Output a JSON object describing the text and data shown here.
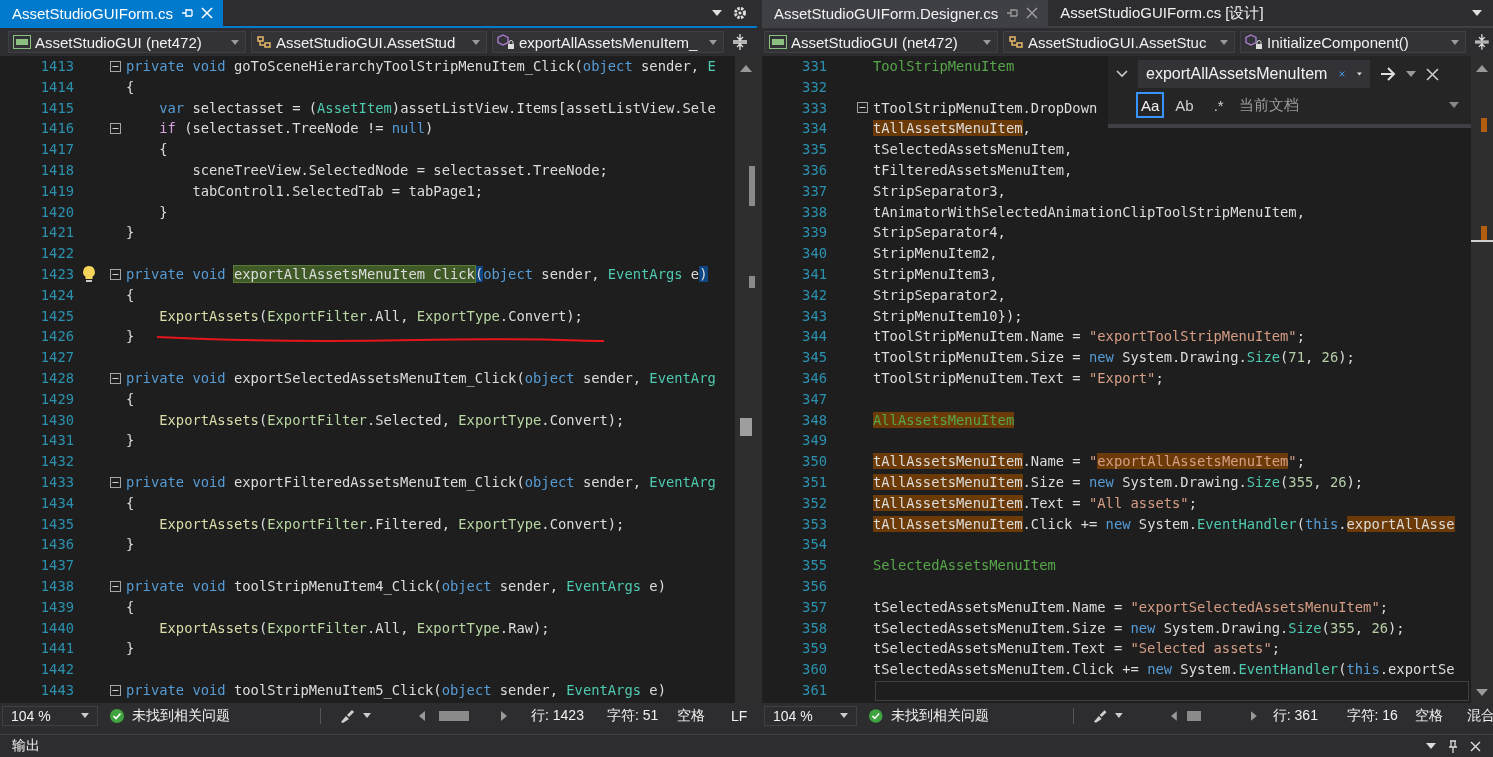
{
  "panes": [
    {
      "focused": true,
      "tabs": [
        {
          "label": "AssetStudioGUIForm.cs",
          "selected": true
        }
      ],
      "nav": {
        "project": "AssetStudioGUI (net472)",
        "class": "AssetStudioGUI.AssetStud",
        "member": "exportAllAssetsMenuItem_"
      },
      "lines": [
        {
          "n": "1413",
          "fold": true,
          "tokens": [
            {
              "text": "private void ",
              "kind": "kw"
            },
            {
              "text": "goToSceneHierarchyToolStripMenuItem_Click(",
              "kind": "plain"
            },
            {
              "text": "object ",
              "kind": "kw"
            },
            {
              "text": "sender, ",
              "kind": "plain"
            },
            {
              "text": "E",
              "kind": "type"
            }
          ]
        },
        {
          "n": "1414",
          "tokens": [
            {
              "text": "{",
              "kind": "plain"
            }
          ]
        },
        {
          "n": "1415",
          "tokens": [
            {
              "text": "    var",
              "kind": "kw"
            },
            {
              "text": " selectasset = (",
              "kind": "plain"
            },
            {
              "text": "AssetItem",
              "kind": "type"
            },
            {
              "text": ")assetListView.Items[assetListView.Sele",
              "kind": "plain"
            }
          ]
        },
        {
          "n": "1416",
          "fold": true,
          "tokens": [
            {
              "text": "    if",
              "kind": "ctrl"
            },
            {
              "text": " (selectasset.TreeNode != ",
              "kind": "plain"
            },
            {
              "text": "null",
              "kind": "kw"
            },
            {
              "text": ")",
              "kind": "plain"
            }
          ]
        },
        {
          "n": "1417",
          "tokens": [
            {
              "text": "    {",
              "kind": "plain"
            }
          ]
        },
        {
          "n": "1418",
          "tokens": [
            {
              "text": "        sceneTreeView.SelectedNode = selectasset.TreeNode;",
              "kind": "plain"
            }
          ]
        },
        {
          "n": "1419",
          "tokens": [
            {
              "text": "        tabControl1.SelectedTab = tabPage1;",
              "kind": "plain"
            }
          ]
        },
        {
          "n": "1420",
          "tokens": [
            {
              "text": "    }",
              "kind": "plain"
            }
          ]
        },
        {
          "n": "1421",
          "tokens": [
            {
              "text": "}",
              "kind": "plain"
            }
          ]
        },
        {
          "n": "1422"
        },
        {
          "n": "1423",
          "fold": true,
          "lightbulb": true,
          "tokens": [
            {
              "text": "private void ",
              "kind": "kw"
            },
            {
              "text": "exportAllAssetsMenuItem_Click",
              "kind": "plain",
              "definition_match": true
            },
            {
              "text": "(",
              "kind": "plain",
              "brace_match": true
            },
            {
              "text": "object ",
              "kind": "kw"
            },
            {
              "text": "sender, ",
              "kind": "plain"
            },
            {
              "text": "EventArgs",
              "kind": "type"
            },
            {
              "text": " e",
              "kind": "plain"
            },
            {
              "text": ")",
              "kind": "plain",
              "brace_match": true
            }
          ]
        },
        {
          "n": "1424",
          "tokens": [
            {
              "text": "{",
              "kind": "plain"
            }
          ]
        },
        {
          "n": "1425",
          "tokens": [
            {
              "text": "    ExportAssets",
              "kind": "method"
            },
            {
              "text": "(",
              "kind": "plain"
            },
            {
              "text": "ExportFilter",
              "kind": "enum"
            },
            {
              "text": ".All, ",
              "kind": "plain"
            },
            {
              "text": "ExportType",
              "kind": "enum"
            },
            {
              "text": ".Convert);",
              "kind": "plain"
            }
          ]
        },
        {
          "n": "1426",
          "tokens": [
            {
              "text": "}",
              "kind": "plain"
            }
          ]
        },
        {
          "n": "1427"
        },
        {
          "n": "1428",
          "fold": true,
          "tokens": [
            {
              "text": "private void ",
              "kind": "kw"
            },
            {
              "text": "exportSelectedAssetsMenuItem_Click(",
              "kind": "plain"
            },
            {
              "text": "object ",
              "kind": "kw"
            },
            {
              "text": "sender, ",
              "kind": "plain"
            },
            {
              "text": "EventArg",
              "kind": "type"
            }
          ]
        },
        {
          "n": "1429",
          "tokens": [
            {
              "text": "{",
              "kind": "plain"
            }
          ]
        },
        {
          "n": "1430",
          "tokens": [
            {
              "text": "    ExportAssets",
              "kind": "method"
            },
            {
              "text": "(",
              "kind": "plain"
            },
            {
              "text": "ExportFilter",
              "kind": "enum"
            },
            {
              "text": ".Selected, ",
              "kind": "plain"
            },
            {
              "text": "ExportType",
              "kind": "enum"
            },
            {
              "text": ".Convert);",
              "kind": "plain"
            }
          ]
        },
        {
          "n": "1431",
          "tokens": [
            {
              "text": "}",
              "kind": "plain"
            }
          ]
        },
        {
          "n": "1432"
        },
        {
          "n": "1433",
          "fold": true,
          "tokens": [
            {
              "text": "private void ",
              "kind": "kw"
            },
            {
              "text": "exportFilteredAssetsMenuItem_Click(",
              "kind": "plain"
            },
            {
              "text": "object ",
              "kind": "kw"
            },
            {
              "text": "sender, ",
              "kind": "plain"
            },
            {
              "text": "EventArg",
              "kind": "type"
            }
          ]
        },
        {
          "n": "1434",
          "tokens": [
            {
              "text": "{",
              "kind": "plain"
            }
          ]
        },
        {
          "n": "1435",
          "tokens": [
            {
              "text": "    ExportAssets",
              "kind": "method"
            },
            {
              "text": "(",
              "kind": "plain"
            },
            {
              "text": "ExportFilter",
              "kind": "enum"
            },
            {
              "text": ".Filtered, ",
              "kind": "plain"
            },
            {
              "text": "ExportType",
              "kind": "enum"
            },
            {
              "text": ".Convert);",
              "kind": "plain"
            }
          ]
        },
        {
          "n": "1436",
          "tokens": [
            {
              "text": "}",
              "kind": "plain"
            }
          ]
        },
        {
          "n": "1437"
        },
        {
          "n": "1438",
          "fold": true,
          "tokens": [
            {
              "text": "private void ",
              "kind": "kw"
            },
            {
              "text": "toolStripMenuItem4_Click(",
              "kind": "plain"
            },
            {
              "text": "object ",
              "kind": "kw"
            },
            {
              "text": "sender, ",
              "kind": "plain"
            },
            {
              "text": "EventArgs",
              "kind": "type"
            },
            {
              "text": " e)",
              "kind": "plain"
            }
          ]
        },
        {
          "n": "1439",
          "tokens": [
            {
              "text": "{",
              "kind": "plain"
            }
          ]
        },
        {
          "n": "1440",
          "tokens": [
            {
              "text": "    ExportAssets",
              "kind": "method"
            },
            {
              "text": "(",
              "kind": "plain"
            },
            {
              "text": "ExportFilter",
              "kind": "enum"
            },
            {
              "text": ".All, ",
              "kind": "plain"
            },
            {
              "text": "ExportType",
              "kind": "enum"
            },
            {
              "text": ".Raw);",
              "kind": "plain"
            }
          ]
        },
        {
          "n": "1441",
          "tokens": [
            {
              "text": "}",
              "kind": "plain"
            }
          ]
        },
        {
          "n": "1442"
        },
        {
          "n": "1443",
          "fold": true,
          "tokens": [
            {
              "text": "private void ",
              "kind": "kw"
            },
            {
              "text": "toolStripMenuItem5_Click(",
              "kind": "plain"
            },
            {
              "text": "object ",
              "kind": "kw"
            },
            {
              "text": "sender, ",
              "kind": "plain"
            },
            {
              "text": "EventArgs",
              "kind": "type"
            },
            {
              "text": " e)",
              "kind": "plain"
            }
          ]
        }
      ],
      "status": {
        "zoom": "104 %",
        "issues": "未找到相关问题",
        "line": "行: 1423",
        "char": "字符: 51",
        "indent": "空格",
        "eol": "LF"
      }
    },
    {
      "focused": false,
      "tabs": [
        {
          "label": "AssetStudioGUIForm.Designer.cs",
          "selected": true
        },
        {
          "label": "AssetStudioGUIForm.cs [设计]",
          "selected": false
        }
      ],
      "nav": {
        "project": "AssetStudioGUI (net472)",
        "class": "AssetStudioGUI.AssetStuc",
        "member": "InitializeComponent()"
      },
      "lines": [
        {
          "n": "331",
          "tokens": [
            {
              "text": "ToolStripMenuItem",
              "kind": "comment"
            }
          ]
        },
        {
          "n": "332"
        },
        {
          "n": "333",
          "fold": true,
          "tokens": [
            {
              "text": "tToolStripMenuItem.DropDown",
              "kind": "plain"
            }
          ]
        },
        {
          "n": "334",
          "tokens": [
            {
              "text": "tAllAssetsMenuItem",
              "kind": "plain",
              "search_match": true
            },
            {
              "text": ",",
              "kind": "plain"
            }
          ]
        },
        {
          "n": "335",
          "tokens": [
            {
              "text": "tSelectedAssetsMenuItem,",
              "kind": "plain"
            }
          ]
        },
        {
          "n": "336",
          "tokens": [
            {
              "text": "tFilteredAssetsMenuItem,",
              "kind": "plain"
            }
          ]
        },
        {
          "n": "337",
          "tokens": [
            {
              "text": "StripSeparator3,",
              "kind": "plain"
            }
          ]
        },
        {
          "n": "338",
          "tokens": [
            {
              "text": "tAnimatorWithSelectedAnimationClipToolStripMenuItem,",
              "kind": "plain"
            }
          ]
        },
        {
          "n": "339",
          "tokens": [
            {
              "text": "StripSeparator4,",
              "kind": "plain"
            }
          ]
        },
        {
          "n": "340",
          "tokens": [
            {
              "text": "StripMenuItem2,",
              "kind": "plain"
            }
          ]
        },
        {
          "n": "341",
          "tokens": [
            {
              "text": "StripMenuItem3,",
              "kind": "plain"
            }
          ]
        },
        {
          "n": "342",
          "tokens": [
            {
              "text": "StripSeparator2,",
              "kind": "plain"
            }
          ]
        },
        {
          "n": "343",
          "tokens": [
            {
              "text": "StripMenuItem10});",
              "kind": "plain"
            }
          ]
        },
        {
          "n": "344",
          "tokens": [
            {
              "text": "tToolStripMenuItem.Name = ",
              "kind": "plain"
            },
            {
              "text": "\"exportToolStripMenuItem\"",
              "kind": "str"
            },
            {
              "text": ";",
              "kind": "plain"
            }
          ]
        },
        {
          "n": "345",
          "tokens": [
            {
              "text": "tToolStripMenuItem.Size = ",
              "kind": "plain"
            },
            {
              "text": "new",
              "kind": "kw"
            },
            {
              "text": " System.Drawing.",
              "kind": "plain"
            },
            {
              "text": "Size",
              "kind": "type"
            },
            {
              "text": "(",
              "kind": "plain"
            },
            {
              "text": "71",
              "kind": "num"
            },
            {
              "text": ", ",
              "kind": "plain"
            },
            {
              "text": "26",
              "kind": "num"
            },
            {
              "text": ");",
              "kind": "plain"
            }
          ]
        },
        {
          "n": "346",
          "tokens": [
            {
              "text": "tToolStripMenuItem.Text = ",
              "kind": "plain"
            },
            {
              "text": "\"Export\"",
              "kind": "str"
            },
            {
              "text": ";",
              "kind": "plain"
            }
          ]
        },
        {
          "n": "347"
        },
        {
          "n": "348",
          "tokens": [
            {
              "text": "AllAssetsMenuItem",
              "kind": "comment",
              "search_match": true
            }
          ]
        },
        {
          "n": "349"
        },
        {
          "n": "350",
          "tokens": [
            {
              "text": "tAllAssetsMenuItem",
              "kind": "plain",
              "search_match": true
            },
            {
              "text": ".Name = ",
              "kind": "plain"
            },
            {
              "text": "\"",
              "kind": "str"
            },
            {
              "text": "exportAllAssetsMenuItem",
              "kind": "str",
              "search_match": true
            },
            {
              "text": "\"",
              "kind": "str"
            },
            {
              "text": ";",
              "kind": "plain"
            }
          ]
        },
        {
          "n": "351",
          "tokens": [
            {
              "text": "tAllAssetsMenuItem",
              "kind": "plain",
              "search_match": true
            },
            {
              "text": ".Size = ",
              "kind": "plain"
            },
            {
              "text": "new",
              "kind": "kw"
            },
            {
              "text": " System.Drawing.",
              "kind": "plain"
            },
            {
              "text": "Size",
              "kind": "type"
            },
            {
              "text": "(",
              "kind": "plain"
            },
            {
              "text": "355",
              "kind": "num"
            },
            {
              "text": ", ",
              "kind": "plain"
            },
            {
              "text": "26",
              "kind": "num"
            },
            {
              "text": ");",
              "kind": "plain"
            }
          ]
        },
        {
          "n": "352",
          "tokens": [
            {
              "text": "tAllAssetsMenuItem",
              "kind": "plain",
              "search_match": true
            },
            {
              "text": ".Text = ",
              "kind": "plain"
            },
            {
              "text": "\"All assets\"",
              "kind": "str"
            },
            {
              "text": ";",
              "kind": "plain"
            }
          ]
        },
        {
          "n": "353",
          "tokens": [
            {
              "text": "tAllAssetsMenuItem",
              "kind": "plain",
              "search_match": true
            },
            {
              "text": ".Click += ",
              "kind": "plain"
            },
            {
              "text": "new",
              "kind": "kw"
            },
            {
              "text": " System.",
              "kind": "plain"
            },
            {
              "text": "EventHandler",
              "kind": "type"
            },
            {
              "text": "(",
              "kind": "plain"
            },
            {
              "text": "this",
              "kind": "kw"
            },
            {
              "text": ".",
              "kind": "plain"
            },
            {
              "text": "exportAllAsse",
              "kind": "plain",
              "search_match": true
            }
          ]
        },
        {
          "n": "354"
        },
        {
          "n": "355",
          "tokens": [
            {
              "text": "SelectedAssetsMenuItem",
              "kind": "comment"
            }
          ]
        },
        {
          "n": "356"
        },
        {
          "n": "357",
          "tokens": [
            {
              "text": "tSelectedAssetsMenuItem.Name = ",
              "kind": "plain"
            },
            {
              "text": "\"exportSelectedAssetsMenuItem\"",
              "kind": "str"
            },
            {
              "text": ";",
              "kind": "plain"
            }
          ]
        },
        {
          "n": "358",
          "tokens": [
            {
              "text": "tSelectedAssetsMenuItem.Size = ",
              "kind": "plain"
            },
            {
              "text": "new",
              "kind": "kw"
            },
            {
              "text": " System.Drawing.",
              "kind": "plain"
            },
            {
              "text": "Size",
              "kind": "type"
            },
            {
              "text": "(",
              "kind": "plain"
            },
            {
              "text": "355",
              "kind": "num"
            },
            {
              "text": ", ",
              "kind": "plain"
            },
            {
              "text": "26",
              "kind": "num"
            },
            {
              "text": ");",
              "kind": "plain"
            }
          ]
        },
        {
          "n": "359",
          "tokens": [
            {
              "text": "tSelectedAssetsMenuItem.Text = ",
              "kind": "plain"
            },
            {
              "text": "\"Selected assets\"",
              "kind": "str"
            },
            {
              "text": ";",
              "kind": "plain"
            }
          ]
        },
        {
          "n": "360",
          "tokens": [
            {
              "text": "tSelectedAssetsMenuItem.Click += ",
              "kind": "plain"
            },
            {
              "text": "new",
              "kind": "kw"
            },
            {
              "text": " System.",
              "kind": "plain"
            },
            {
              "text": "EventHandler",
              "kind": "type"
            },
            {
              "text": "(",
              "kind": "plain"
            },
            {
              "text": "this",
              "kind": "kw"
            },
            {
              "text": ".exportSe",
              "kind": "plain"
            }
          ]
        },
        {
          "n": "361"
        }
      ],
      "find": {
        "value": "exportAllAssetsMenuItem",
        "options": [
          {
            "label": "Aa",
            "selected": true
          },
          {
            "label": "Ab",
            "selected": false
          },
          {
            "label": ".*",
            "selected": false
          }
        ],
        "scope": "当前文档"
      },
      "status": {
        "zoom": "104 %",
        "issues": "未找到相关问题",
        "line": "行: 361",
        "char": "字符: 16",
        "indent": "空格",
        "eol": "混合"
      }
    }
  ],
  "output_panel": {
    "title": "输出"
  }
}
